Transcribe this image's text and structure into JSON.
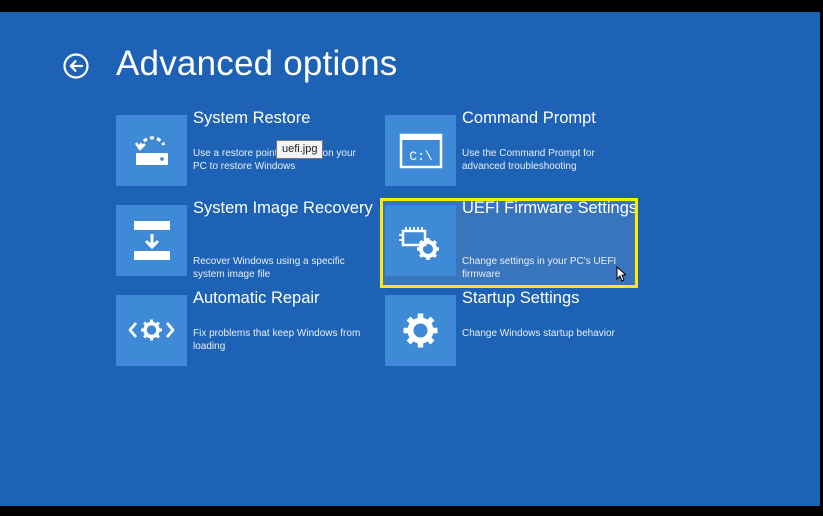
{
  "page": {
    "title": "Advanced options",
    "back_icon": "back-arrow-circle-icon"
  },
  "tiles": [
    {
      "id": "system-restore",
      "title": "System Restore",
      "description": "Use a restore point recorded on your PC to restore Windows",
      "icon": "restore-icon"
    },
    {
      "id": "command-prompt",
      "title": "Command Prompt",
      "description": "Use the Command Prompt for advanced troubleshooting",
      "icon": "command-prompt-icon",
      "icon_text": "C:\\"
    },
    {
      "id": "system-image-recovery",
      "title": "System Image Recovery",
      "description": "Recover Windows using a specific system image file",
      "icon": "image-recovery-icon"
    },
    {
      "id": "uefi-firmware-settings",
      "title": "UEFI Firmware Settings",
      "description": "Change settings in your PC's UEFI firmware",
      "icon": "firmware-chip-gear-icon",
      "highlighted": true
    },
    {
      "id": "automatic-repair",
      "title": "Automatic Repair",
      "description": "Fix problems that keep Windows from loading",
      "icon": "repair-icon"
    },
    {
      "id": "startup-settings",
      "title": "Startup Settings",
      "description": "Change Windows startup behavior",
      "icon": "gear-icon"
    }
  ],
  "tooltip": {
    "text": "uefi.jpg"
  },
  "colors": {
    "background": "#1d62b4",
    "tile_icon_bg": "#3e8ad6",
    "highlight": "#ffea00"
  }
}
